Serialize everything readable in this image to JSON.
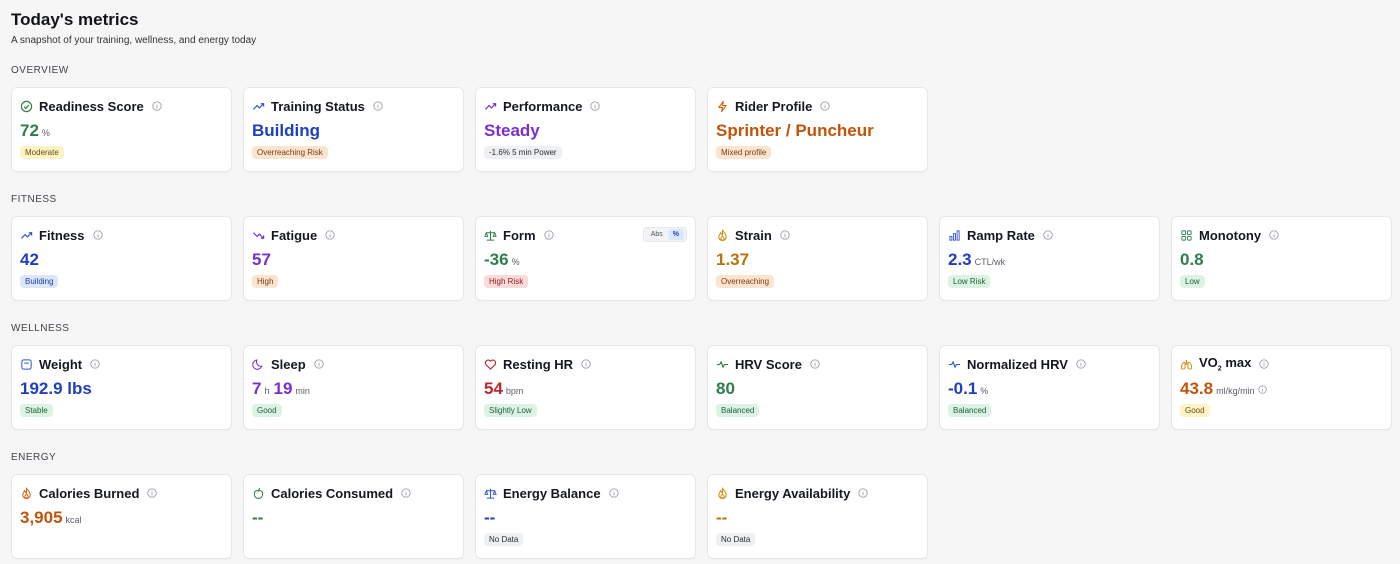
{
  "header": {
    "title": "Today's metrics",
    "subtitle": "A snapshot of your training, wellness, and energy today"
  },
  "sections": {
    "overview": "OVERVIEW",
    "fitness": "FITNESS",
    "wellness": "WELLNESS",
    "energy": "ENERGY"
  },
  "overview": {
    "readiness": {
      "label": "Readiness Score",
      "value": "72",
      "unit": "%",
      "badge": "Moderate",
      "icon": "check-circle-icon"
    },
    "training_status": {
      "label": "Training Status",
      "value": "Building",
      "badge": "Overreaching Risk",
      "icon": "trending-up-icon"
    },
    "performance": {
      "label": "Performance",
      "value": "Steady",
      "badge": "-1.6% 5 min Power",
      "icon": "trending-up-icon"
    },
    "rider_profile": {
      "label": "Rider Profile",
      "value": "Sprinter / Puncheur",
      "badge": "Mixed profile",
      "icon": "lightning-icon"
    }
  },
  "fitness": {
    "fitness": {
      "label": "Fitness",
      "value": "42",
      "badge": "Building",
      "icon": "trending-up-icon"
    },
    "fatigue": {
      "label": "Fatigue",
      "value": "57",
      "badge": "High",
      "icon": "trending-down-icon"
    },
    "form": {
      "label": "Form",
      "value": "-36",
      "unit": "%",
      "badge": "High Risk",
      "icon": "scale-icon",
      "toggle_abs": "Abs",
      "toggle_pct": "%"
    },
    "strain": {
      "label": "Strain",
      "value": "1.37",
      "badge": "Overreaching",
      "icon": "flame-icon"
    },
    "ramp_rate": {
      "label": "Ramp Rate",
      "value": "2.3",
      "unit": "CTL/wk",
      "badge": "Low Risk",
      "icon": "bar-chart-icon"
    },
    "monotony": {
      "label": "Monotony",
      "value": "0.8",
      "badge": "Low",
      "icon": "grid-icon"
    }
  },
  "wellness": {
    "weight": {
      "label": "Weight",
      "value": "192.9 lbs",
      "badge": "Stable",
      "icon": "scale-weight-icon"
    },
    "sleep": {
      "label": "Sleep",
      "hours": "7",
      "hours_unit": "h",
      "minutes": "19",
      "minutes_unit": "min",
      "badge": "Good",
      "icon": "moon-icon"
    },
    "resting_hr": {
      "label": "Resting HR",
      "value": "54",
      "unit": "bpm",
      "badge": "Slightly Low",
      "icon": "heart-icon"
    },
    "hrv_score": {
      "label": "HRV Score",
      "value": "80",
      "badge": "Balanced",
      "icon": "pulse-icon"
    },
    "normalized_hrv": {
      "label": "Normalized HRV",
      "value": "-0.1",
      "unit": "%",
      "badge": "Balanced",
      "icon": "pulse-icon"
    },
    "vo2max": {
      "label_main": "VO",
      "label_sub": "2",
      "label_rest": " max",
      "value": "43.8",
      "unit": "ml/kg/min",
      "badge": "Good",
      "icon": "lungs-icon"
    }
  },
  "energy": {
    "calories_burned": {
      "label": "Calories Burned",
      "value": "3,905",
      "unit": "kcal",
      "icon": "flame-icon"
    },
    "calories_consumed": {
      "label": "Calories Consumed",
      "value": "--",
      "icon": "apple-icon"
    },
    "energy_balance": {
      "label": "Energy Balance",
      "value": "--",
      "badge": "No Data",
      "icon": "scale-icon"
    },
    "energy_availability": {
      "label": "Energy Availability",
      "value": "--",
      "badge": "No Data",
      "icon": "flame-icon"
    }
  },
  "colors": {
    "green": "#2e7d4f",
    "blue": "#1f3fbf",
    "purple": "#7b2fd1",
    "orange": "#c2540a",
    "amber": "#b8730a",
    "red": "#c0262d",
    "badge_yellow_bg": "#fef3c7",
    "badge_orange_bg": "#fde4cf",
    "badge_red_bg": "#fcdada",
    "badge_green_bg": "#dcf3e3",
    "badge_blue_bg": "#dce6fb",
    "badge_gray_bg": "#eef0f2"
  }
}
